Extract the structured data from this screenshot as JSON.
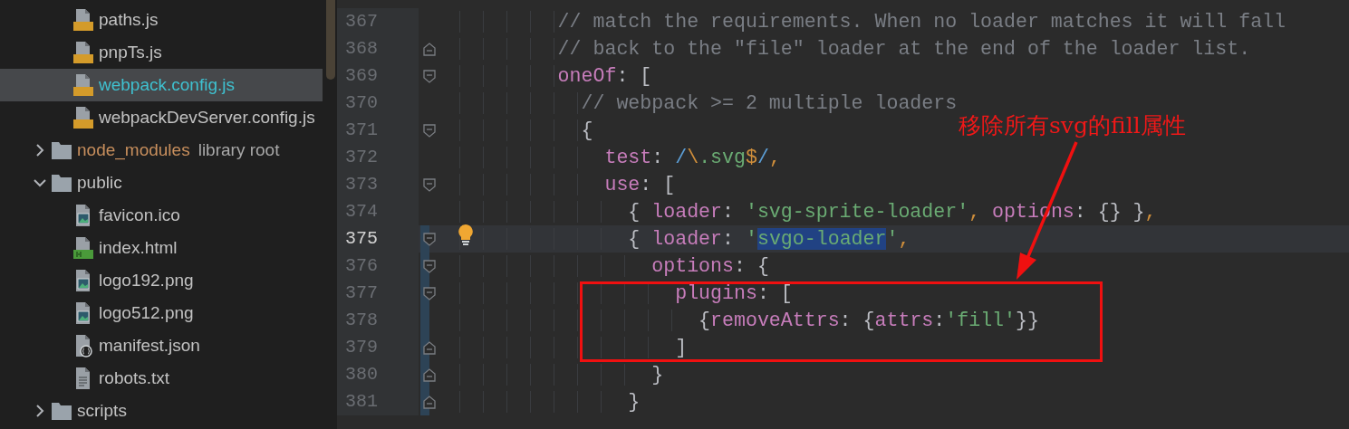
{
  "project_tree": [
    {
      "children": [
        {
          "label": "paths.js",
          "kind": "js",
          "selected": false
        },
        {
          "label": "pnpTs.js",
          "kind": "js",
          "selected": false
        },
        {
          "label": "webpack.config.js",
          "kind": "js",
          "selected": true
        },
        {
          "label": "webpackDevServer.config.js",
          "kind": "js",
          "selected": false
        }
      ]
    },
    {
      "label": "node_modules",
      "note": "library root",
      "kind": "excluded-folder",
      "expanded": false,
      "selected": false
    },
    {
      "label": "public",
      "kind": "folder",
      "expanded": true,
      "selected": false,
      "children": [
        {
          "label": "favicon.ico",
          "kind": "image",
          "selected": false
        },
        {
          "label": "index.html",
          "kind": "html",
          "selected": false
        },
        {
          "label": "logo192.png",
          "kind": "image",
          "selected": false
        },
        {
          "label": "logo512.png",
          "kind": "image",
          "selected": false
        },
        {
          "label": "manifest.json",
          "kind": "json",
          "selected": false
        },
        {
          "label": "robots.txt",
          "kind": "text",
          "selected": false
        }
      ]
    },
    {
      "label": "scripts",
      "kind": "folder",
      "expanded": false,
      "selected": false
    }
  ],
  "editor": {
    "lines": [
      {
        "number": "367",
        "current": false,
        "modified": false,
        "fold_open": false,
        "fold_close": false,
        "tokens": [
          {
            "t": "          // match the requirements. When no loader matches it will fall",
            "kind": "comment"
          }
        ]
      },
      {
        "number": "368",
        "current": false,
        "modified": false,
        "fold_open": false,
        "fold_close": true,
        "tokens": [
          {
            "t": "          // back to the \"file\" loader at the end of the loader list.",
            "kind": "comment"
          }
        ]
      },
      {
        "number": "369",
        "current": false,
        "modified": false,
        "fold_open": true,
        "fold_close": false,
        "tokens": [
          {
            "t": "          oneOf",
            "kind": "key"
          },
          {
            "t": ": ",
            "kind": "punct"
          },
          {
            "t": "[",
            "kind": "bracket"
          }
        ]
      },
      {
        "number": "370",
        "current": false,
        "modified": false,
        "fold_open": false,
        "fold_close": false,
        "tokens": [
          {
            "t": "            // webpack >= 2 multiple loaders",
            "kind": "comment"
          }
        ]
      },
      {
        "number": "371",
        "current": false,
        "modified": false,
        "fold_open": true,
        "fold_close": false,
        "tokens": [
          {
            "t": "            {",
            "kind": "bracket"
          }
        ]
      },
      {
        "number": "372",
        "current": false,
        "modified": false,
        "fold_open": false,
        "fold_close": false,
        "tokens": [
          {
            "t": "              test",
            "kind": "key"
          },
          {
            "t": ": ",
            "kind": "punct"
          },
          {
            "t": "/",
            "kind": "regex"
          },
          {
            "t": "\\",
            "kind": "escape"
          },
          {
            "t": ".svg",
            "kind": "string"
          },
          {
            "t": "$",
            "kind": "escape"
          },
          {
            "t": "/",
            "kind": "regex"
          },
          {
            "t": ",",
            "kind": "comma"
          }
        ]
      },
      {
        "number": "373",
        "current": false,
        "modified": false,
        "fold_open": true,
        "fold_close": false,
        "tokens": [
          {
            "t": "              use",
            "kind": "key"
          },
          {
            "t": ": ",
            "kind": "punct"
          },
          {
            "t": "[",
            "kind": "bracket"
          }
        ]
      },
      {
        "number": "374",
        "current": false,
        "modified": false,
        "fold_open": false,
        "fold_close": false,
        "tokens": [
          {
            "t": "                { ",
            "kind": "bracket"
          },
          {
            "t": "loader",
            "kind": "key"
          },
          {
            "t": ": ",
            "kind": "punct"
          },
          {
            "t": "'svg-sprite-loader'",
            "kind": "string"
          },
          {
            "t": ", ",
            "kind": "comma"
          },
          {
            "t": "options",
            "kind": "key"
          },
          {
            "t": ": ",
            "kind": "punct"
          },
          {
            "t": "{} }",
            "kind": "bracket"
          },
          {
            "t": ",",
            "kind": "comma"
          }
        ]
      },
      {
        "number": "375",
        "current": true,
        "modified": true,
        "fold_open": true,
        "fold_close": false,
        "tokens": [
          {
            "t": "                { ",
            "kind": "bracket"
          },
          {
            "t": "loader",
            "kind": "key"
          },
          {
            "t": ": ",
            "kind": "punct"
          },
          {
            "t": "'",
            "kind": "string"
          },
          {
            "t": "svgo-loader",
            "kind": "string",
            "selected": true
          },
          {
            "t": "'",
            "kind": "string"
          },
          {
            "t": ",",
            "kind": "comma"
          }
        ]
      },
      {
        "number": "376",
        "current": false,
        "modified": true,
        "fold_open": true,
        "fold_close": false,
        "tokens": [
          {
            "t": "                  options",
            "kind": "key"
          },
          {
            "t": ": ",
            "kind": "punct"
          },
          {
            "t": "{",
            "kind": "bracket"
          }
        ]
      },
      {
        "number": "377",
        "current": false,
        "modified": true,
        "fold_open": true,
        "fold_close": false,
        "tokens": [
          {
            "t": "                    plugins",
            "kind": "key"
          },
          {
            "t": ": ",
            "kind": "punct"
          },
          {
            "t": "[",
            "kind": "bracket"
          }
        ]
      },
      {
        "number": "378",
        "current": false,
        "modified": true,
        "fold_open": false,
        "fold_close": false,
        "tokens": [
          {
            "t": "                      {",
            "kind": "bracket"
          },
          {
            "t": "removeAttrs",
            "kind": "key"
          },
          {
            "t": ": ",
            "kind": "punct"
          },
          {
            "t": "{",
            "kind": "bracket"
          },
          {
            "t": "attrs",
            "kind": "key"
          },
          {
            "t": ":",
            "kind": "punct"
          },
          {
            "t": "'fill'",
            "kind": "string"
          },
          {
            "t": "}}",
            "kind": "bracket"
          }
        ]
      },
      {
        "number": "379",
        "current": false,
        "modified": true,
        "fold_open": false,
        "fold_close": true,
        "tokens": [
          {
            "t": "                    ]",
            "kind": "bracket"
          }
        ]
      },
      {
        "number": "380",
        "current": false,
        "modified": true,
        "fold_open": false,
        "fold_close": true,
        "tokens": [
          {
            "t": "                  }",
            "kind": "bracket"
          }
        ]
      },
      {
        "number": "381",
        "current": false,
        "modified": true,
        "fold_open": false,
        "fold_close": true,
        "tokens": [
          {
            "t": "                }",
            "kind": "bracket"
          }
        ]
      }
    ]
  },
  "annotation": {
    "text": "移除所有svg的fill属性"
  }
}
